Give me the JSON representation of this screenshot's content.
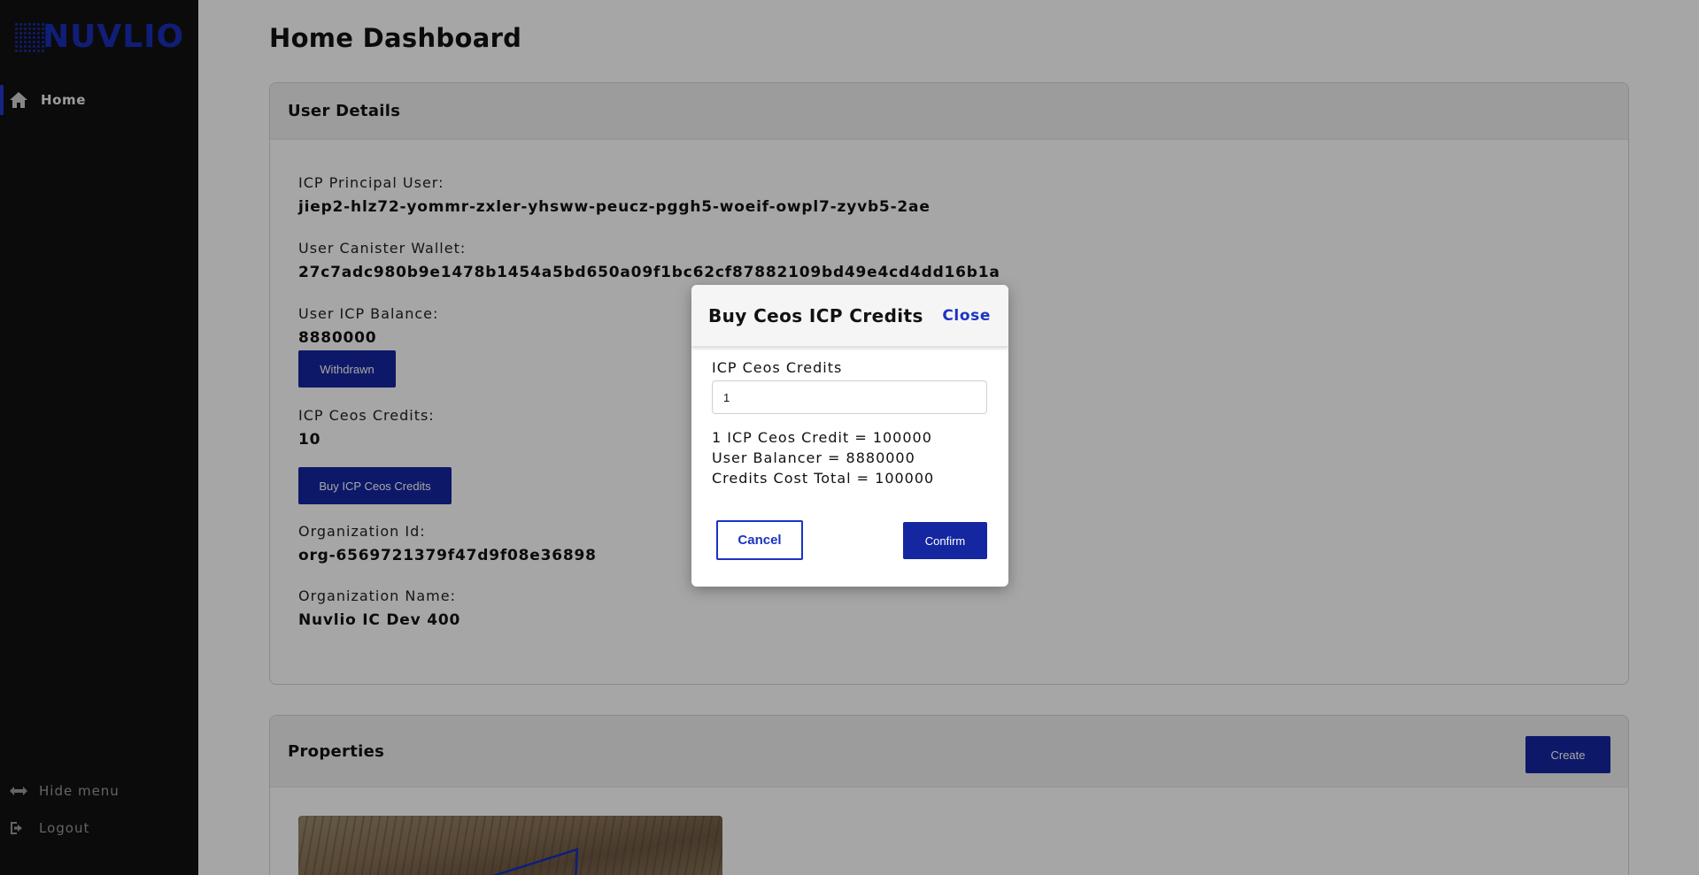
{
  "app": {
    "logo_text": "NUVLIO",
    "brand_color": "#1b2fb8"
  },
  "sidebar": {
    "items": [
      {
        "label": "Home",
        "icon": "home-icon",
        "active": true
      }
    ],
    "hide_menu_label": "Hide menu",
    "logout_label": "Logout"
  },
  "page": {
    "title": "Home Dashboard"
  },
  "user_details": {
    "title": "User Details",
    "principal_label": "ICP Principal User:",
    "principal_value": "jiep2-hlz72-yommr-zxler-yhsww-peucz-pggh5-woeif-owpl7-zyvb5-2ae",
    "wallet_label": "User Canister Wallet:",
    "wallet_value": "27c7adc980b9e1478b1454a5bd650a09f1bc62cf87882109bd49e4cd4dd16b1a",
    "balance_label": "User ICP Balance:",
    "balance_value": "8880000",
    "withdrawn_button": "Withdrawn",
    "credits_label": "ICP Ceos Credits:",
    "credits_value": "10",
    "buy_button": "Buy ICP Ceos Credits",
    "org_id_label": "Organization Id:",
    "org_id_value": "org-6569721379f47d9f08e36898",
    "org_name_label": "Organization Name:",
    "org_name_value": "Nuvlio IC Dev 400"
  },
  "properties": {
    "title": "Properties",
    "create_button": "Create"
  },
  "modal": {
    "title": "Buy Ceos ICP Credits",
    "close_label": "Close",
    "input_label": "ICP Ceos Credits",
    "input_value": "1",
    "info_lines": [
      "1 ICP Ceos Credit = 100000",
      "User Balancer = 8880000",
      "Credits Cost Total = 100000"
    ],
    "cancel_button": "Cancel",
    "confirm_button": "Confirm"
  },
  "colors": {
    "primary_button": "#1427a0",
    "link": "#1b33c4",
    "sidebar_bg": "#111111"
  }
}
